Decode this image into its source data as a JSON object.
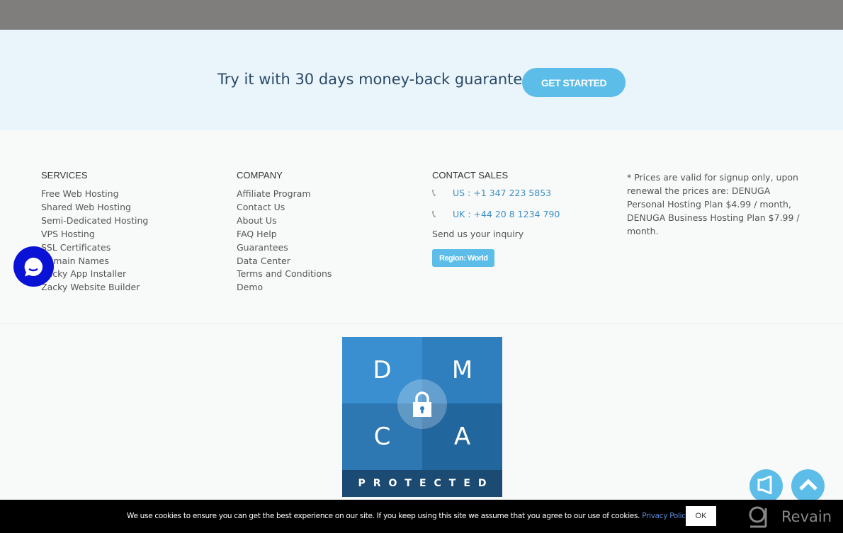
{
  "banner": {
    "text": "Try it with 30 days money-back guarantee.",
    "cta_label": "GET STARTED"
  },
  "services": {
    "heading": "SERVICES",
    "items": [
      "Free Web Hosting",
      "Shared Web Hosting",
      "Semi-Dedicated Hosting",
      "VPS Hosting",
      "SSL Certificates",
      "Domain Names",
      "Zacky App Installer",
      "Zacky Website Builder"
    ]
  },
  "company": {
    "heading": "COMPANY",
    "items": [
      "Affiliate Program",
      "Contact Us",
      "About Us",
      "FAQ Help",
      "Guarantees",
      "Data Center",
      "Terms and Conditions",
      "Demo"
    ]
  },
  "contact": {
    "heading": "CONTACT SALES",
    "us": "US : +1 347 223 5853",
    "uk": "UK : +44 20 8 1234 790",
    "inquiry": "Send us your inquiry",
    "region_label": "Region: World"
  },
  "note": "* Prices are valid for signup only, upon renewal the prices are: DENUGA Personal Hosting Plan $4.99 / month, DENUGA Business Hosting Plan $7.99 / month.",
  "dmca": {
    "letters": [
      "D",
      "M",
      "C",
      "A"
    ],
    "label": "PROTECTED"
  },
  "cookie": {
    "text": "We use cookies to ensure you can get the best experience on our site. If you keep using this site we assume that you agree to our use of cookies.",
    "link": "Privacy Policy",
    "ok_label": "OK"
  },
  "watermark": "Revain",
  "colors": {
    "accent": "#5bbde8",
    "link": "#3a8fc6",
    "chat": "#0a12d6"
  }
}
